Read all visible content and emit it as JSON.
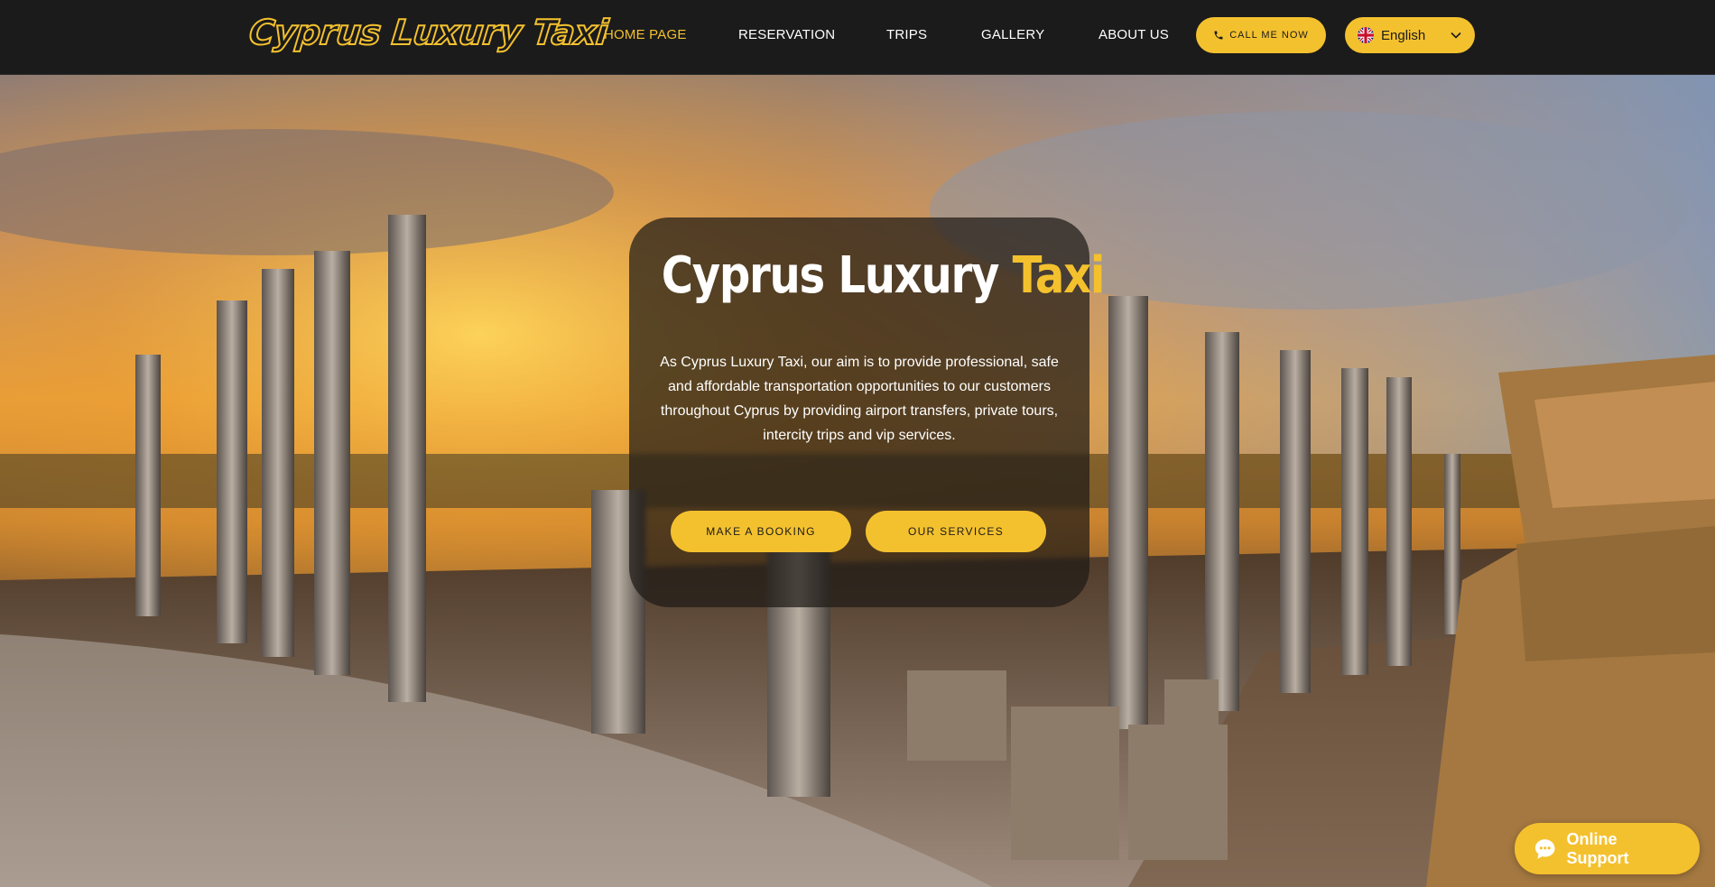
{
  "header": {
    "logo_text": "Cyprus Luxury Taxi",
    "nav": [
      {
        "label": "HOME PAGE",
        "active": true
      },
      {
        "label": "RESERVATION",
        "active": false
      },
      {
        "label": "TRIPS",
        "active": false
      },
      {
        "label": "GALLERY",
        "active": false
      },
      {
        "label": "ABOUT US",
        "active": false
      }
    ],
    "call_label": "CALL ME NOW",
    "language": {
      "selected": "English",
      "flag": "uk-flag-icon"
    }
  },
  "hero": {
    "title_main": "Cyprus Luxury",
    "title_accent": "Taxi",
    "description": "As Cyprus Luxury Taxi, our aim is to provide professional, safe and affordable transportation opportunities to our customers throughout Cyprus by providing airport transfers, private tours, intercity trips and vip services.",
    "primary_button": "MAKE A BOOKING",
    "secondary_button": "OUR SERVICES"
  },
  "support": {
    "label": "Online Support",
    "icon": "chat-bubble-icon"
  },
  "colors": {
    "accent": "#f4c12e",
    "header_bg": "#1b1b1b",
    "text_light": "#ffffff"
  }
}
